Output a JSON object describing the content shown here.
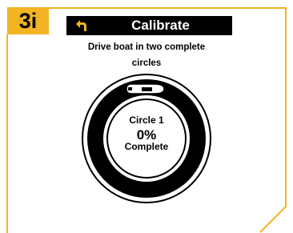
{
  "step": {
    "label": "3i"
  },
  "header": {
    "title": "Calibrate",
    "back_icon": "back-arrow-icon"
  },
  "instruction": {
    "line1": "Drive boat in two complete",
    "line2": "circles"
  },
  "dial": {
    "circle_label": "Circle 1",
    "percent": "0%",
    "complete_label": "Complete",
    "progress_fraction": 0,
    "boat_icon": "boat-icon"
  },
  "colors": {
    "accent": "#f2b324",
    "title_bar": "#000000",
    "title_text": "#ffffff"
  }
}
